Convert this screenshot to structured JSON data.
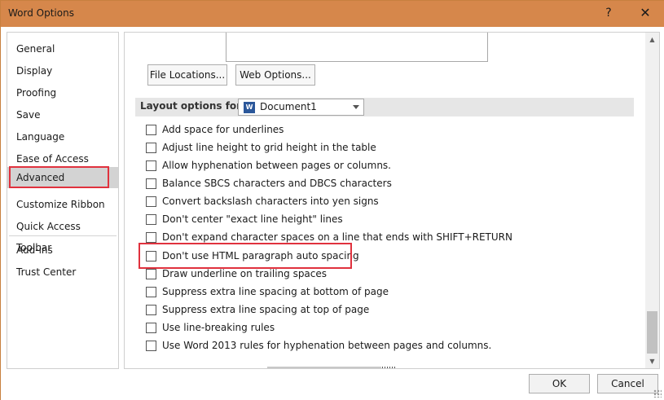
{
  "window": {
    "title": "Word Options",
    "help_label": "?",
    "close_label": "✕"
  },
  "sidebar": {
    "items": [
      {
        "label": "General"
      },
      {
        "label": "Display"
      },
      {
        "label": "Proofing"
      },
      {
        "label": "Save"
      },
      {
        "label": "Language"
      },
      {
        "label": "Ease of Access"
      },
      {
        "label": "Advanced",
        "selected": true
      },
      {
        "label": "Customize Ribbon"
      },
      {
        "label": "Quick Access Toolbar"
      },
      {
        "label": "Add-ins"
      },
      {
        "label": "Trust Center"
      }
    ]
  },
  "main": {
    "buttons": {
      "file_locations": "File Locations...",
      "web_options": "Web Options..."
    },
    "layout_section": {
      "label": "Layout options for:",
      "document_icon": "W",
      "document_select_value": "Document1"
    },
    "options": [
      {
        "label": "Add space for underlines",
        "checked": false
      },
      {
        "label": "Adjust line height to grid height in the table",
        "checked": false
      },
      {
        "label": "Allow hyphenation between pages or columns.",
        "checked": false
      },
      {
        "label": "Balance SBCS characters and DBCS characters",
        "checked": false
      },
      {
        "label": "Convert backslash characters into yen signs",
        "checked": false
      },
      {
        "label": "Don't center \"exact line height\" lines",
        "checked": false
      },
      {
        "label": "Don't expand character spaces on a line that ends with SHIFT+RETURN",
        "checked": false
      },
      {
        "label": "Don't use HTML paragraph auto spacing",
        "checked": false
      },
      {
        "label": "Draw underline on trailing spaces",
        "checked": false
      },
      {
        "label": "Suppress extra line spacing at bottom of page",
        "checked": false
      },
      {
        "label": "Suppress extra line spacing at top of page",
        "checked": false
      },
      {
        "label": "Use line-breaking rules",
        "checked": false
      },
      {
        "label": "Use Word 2013 rules for hyphenation between pages and columns.",
        "checked": false
      }
    ],
    "scroll_up_label": "▲",
    "scroll_down_label": "▼"
  },
  "footer": {
    "ok_label": "OK",
    "cancel_label": "Cancel"
  },
  "colors": {
    "titlebar": "#d6874b",
    "highlight": "#e0323e",
    "selected_nav": "#d3d3d3"
  }
}
